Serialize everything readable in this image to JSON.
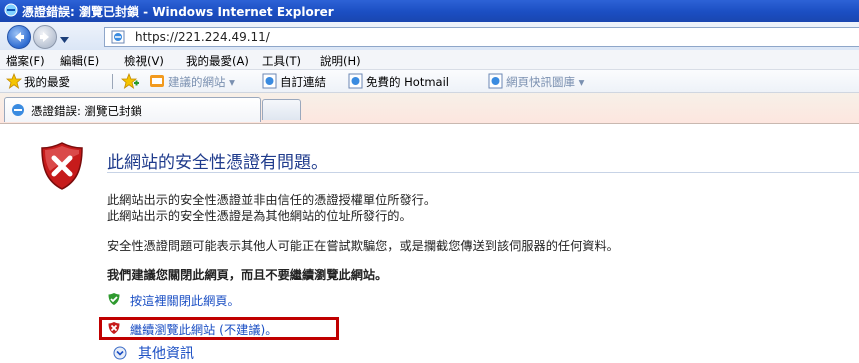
{
  "window": {
    "title": "憑證錯誤: 瀏覽已封鎖 - Windows Internet Explorer"
  },
  "address_bar": {
    "url": "https://221.224.49.11/"
  },
  "menu": {
    "items": [
      "檔案(F)",
      "編輯(E)",
      "檢視(V)",
      "我的最愛(A)",
      "工具(T)",
      "說明(H)"
    ]
  },
  "favorites_bar": {
    "favorites_label": "我的最愛",
    "suggested_sites": "建議的網站 ▾",
    "custom_links": "自訂連結",
    "hotmail": "免費的 Hotmail",
    "web_slice": "網頁快訊圖庫 ▾"
  },
  "tabs": {
    "active_label": "憑證錯誤: 瀏覽已封鎖"
  },
  "page": {
    "heading": "此網站的安全性憑證有問題。",
    "line1": "此網站出示的安全性憑證並非由信任的憑證授權單位所發行。",
    "line2": "此網站出示的安全性憑證是為其他網站的位址所發行的。",
    "line3": "安全性憑證問題可能表示其他人可能正在嘗試欺騙您，或是攔截您傳送到該伺服器的任何資料。",
    "recommendation": "我們建議您關閉此網頁，而且不要繼續瀏覽此網站。",
    "close_link": "按這裡關閉此網頁。",
    "continue_link": "繼續瀏覽此網站 (不建議)。",
    "more_info": "其他資訊"
  },
  "icons": {
    "shield": "shield-error-icon",
    "close_check": "green-check-shield-icon",
    "continue_x": "red-x-shield-icon",
    "more_info": "expand-down-icon"
  },
  "colors": {
    "title_bar": "#1b4ec2",
    "heading": "#1f3b8c",
    "link": "#1b4fc4",
    "highlight_box": "#c00000"
  }
}
